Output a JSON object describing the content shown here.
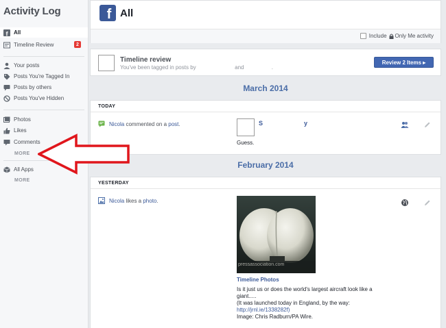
{
  "sidebar": {
    "title": "Activity Log",
    "items": [
      {
        "label": "All",
        "icon": "facebook-icon"
      },
      {
        "label": "Timeline Review",
        "icon": "timeline-icon",
        "badge": "2"
      },
      {
        "label": "Your posts",
        "icon": "person-icon"
      },
      {
        "label": "Posts You're Tagged In",
        "icon": "tag-icon"
      },
      {
        "label": "Posts by others",
        "icon": "speech-icon"
      },
      {
        "label": "Posts You've Hidden",
        "icon": "hidden-icon"
      },
      {
        "label": "Photos",
        "icon": "photos-icon"
      },
      {
        "label": "Likes",
        "icon": "thumb-up-icon"
      },
      {
        "label": "Comments",
        "icon": "comment-icon"
      },
      {
        "label": "All Apps",
        "icon": "apps-icon"
      }
    ],
    "more1": "MORE",
    "more2": "MORE"
  },
  "header": {
    "logo_letter": "f",
    "title": "All",
    "only_me_prefix": "Include",
    "only_me_suffix": "Only Me activity"
  },
  "review": {
    "title": "Timeline review",
    "subtitle_a": "You've been tagged in posts by",
    "subtitle_b": "and",
    "subtitle_c": ".",
    "button": "Review 2 Items ▸"
  },
  "months": {
    "m1": "March 2014",
    "m2": "February 2014"
  },
  "today": {
    "heading": "TODAY",
    "actor": "Nicola",
    "action": " commented on a ",
    "object": "post",
    "end": ".",
    "name_a": "S",
    "name_b": "y",
    "comment": "Guess."
  },
  "yesterday": {
    "heading": "YESTERDAY",
    "actor": "Nicola",
    "action": " likes a ",
    "object": "photo",
    "end": ".",
    "photo_watermark": "pressassociation.com",
    "album": "Timeline Photos",
    "caption": [
      "Is it just us or does the world's largest aircraft look like a",
      "giant.....",
      "(It was launched today in England, by the way:",
      "http://jrnl.ie/1338282f)",
      "Image: Chris Radburn/PA Wire."
    ]
  },
  "colors": {
    "accent": "#3b5998",
    "badge": "#e53935",
    "arrow": "#e0161c"
  }
}
